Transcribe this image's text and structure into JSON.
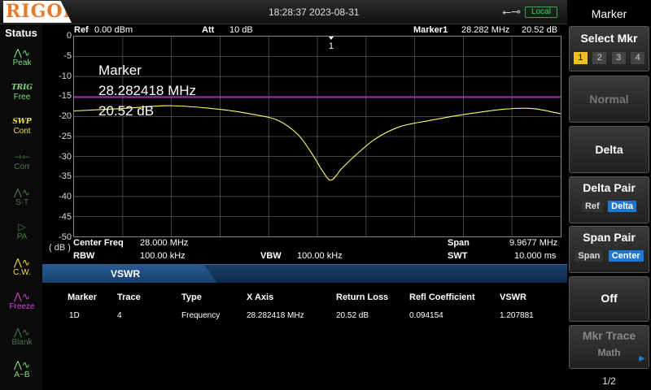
{
  "header": {
    "brand": "RIGOL",
    "datetime": "18:28:37 2023-08-31",
    "usb_icon": "usb-icon",
    "mode_badge": "Local"
  },
  "status_panel": {
    "title": "Status",
    "items": [
      {
        "icon": "peak-icon",
        "label": "Peak",
        "color": "#7de07d"
      },
      {
        "icon": "trig-icon",
        "top": "TRIG",
        "label": "Free",
        "color": "#7de07d"
      },
      {
        "icon": "swp-icon",
        "top": "SWP",
        "label": "Cont",
        "color": "#f0e040"
      },
      {
        "icon": "corr-icon",
        "label": "Corr",
        "color": "#4a7a4a"
      },
      {
        "icon": "st-icon",
        "label": "S-T",
        "color": "#4a7a4a"
      },
      {
        "icon": "pa-icon",
        "label": "PA",
        "color": "#4a7a4a"
      },
      {
        "icon": "cw-icon",
        "label": "C.W.",
        "color": "#f0e040"
      },
      {
        "icon": "freeze-icon",
        "label": "Freeze",
        "color": "#e040e0"
      },
      {
        "icon": "blank-icon",
        "label": "Blank",
        "color": "#4a7a4a"
      },
      {
        "icon": "a-minus-b-icon",
        "label": "A−B",
        "color": "#7de07d"
      }
    ]
  },
  "plot": {
    "ref_label": "Ref",
    "ref_value": "0.00 dBm",
    "att_label": "Att",
    "att_value": "10 dB",
    "marker_label": "Marker1",
    "marker_freq": "28.282 MHz",
    "marker_value": "20.52 dB",
    "marker_flag": "1",
    "y_unit": "( dB )",
    "y_ticks": [
      "0",
      "-5",
      "-10",
      "-15",
      "-20",
      "-25",
      "-30",
      "-35",
      "-40",
      "-45",
      "-50"
    ]
  },
  "marker_readout": {
    "line1": "Marker",
    "line2": "28.282418 MHz",
    "line3": "20.52 dB"
  },
  "params": {
    "center_label": "Center Freq",
    "center_value": "28.000 MHz",
    "span_label": "Span",
    "span_value": "9.9677 MHz",
    "rbw_label": "RBW",
    "rbw_value": "100.00 kHz",
    "vbw_label": "VBW",
    "vbw_value": "100.00 kHz",
    "swt_label": "SWT",
    "swt_value": "10.000 ms"
  },
  "vswr_table": {
    "title": "VSWR",
    "headers": [
      "Marker",
      "Trace",
      "Type",
      "X Axis",
      "Return Loss",
      "Refl Coefficient",
      "VSWR"
    ],
    "rows": [
      [
        "1D",
        "4",
        "Frequency",
        "28.282418 MHz",
        "20.52 dB",
        "0.094154",
        "1.207881"
      ]
    ]
  },
  "softkeys": {
    "menu_title": "Marker",
    "select_mkr": "Select Mkr",
    "mkr_numbers": [
      "1",
      "2",
      "3",
      "4"
    ],
    "normal": "Normal",
    "delta": "Delta",
    "delta_pair": "Delta Pair",
    "delta_pair_opts": [
      "Ref",
      "Delta"
    ],
    "span_pair": "Span Pair",
    "span_pair_opts": [
      "Span",
      "Center"
    ],
    "off": "Off",
    "mkr_trace": "Mkr Trace",
    "mkr_trace_value": "Math",
    "page": "1/2"
  },
  "colors": {
    "trace": "#ffff66",
    "limit_line": "#c020c0",
    "accent_blue": "#1e78d2",
    "mkr_active": "#f0c020"
  },
  "chart_data": {
    "type": "line",
    "xlabel": "",
    "ylabel": "( dB )",
    "ylim": [
      -50,
      0
    ],
    "xlim_mhz": [
      23.0161,
      32.9839
    ],
    "grid": true,
    "series": [
      {
        "values_x_mhz": [
          23.016,
          24.0,
          25.0,
          26.0,
          26.7,
          27.2,
          27.6,
          27.9,
          28.1,
          28.28,
          28.5,
          28.8,
          29.2,
          29.7,
          30.3,
          31.0,
          31.8,
          32.4,
          32.98
        ],
        "values_y_db": [
          -18.6,
          -18.0,
          -17.3,
          -18.2,
          -19.5,
          -21.0,
          -24.5,
          -29.5,
          -33.5,
          -35.9,
          -33.0,
          -29.5,
          -25.5,
          -22.5,
          -21.0,
          -19.5,
          -18.2,
          -18.0,
          -19.3
        ]
      },
      {
        "values_x_mhz": [
          23.016,
          32.98
        ],
        "values_y_db": [
          -15.2,
          -15.2
        ]
      }
    ]
  }
}
